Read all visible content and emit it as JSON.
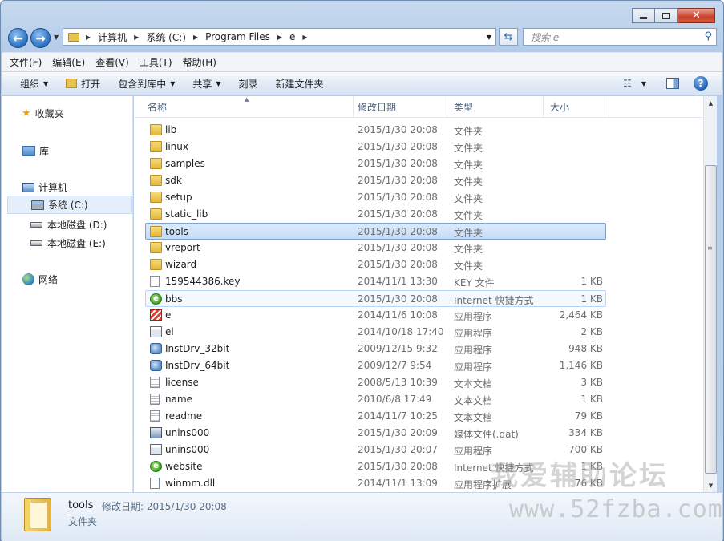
{
  "window": {
    "close_glyph": "✕"
  },
  "address": {
    "crumbs": [
      "计算机",
      "系统 (C:)",
      "Program Files",
      "e"
    ],
    "search_placeholder": "搜索 e"
  },
  "menu": [
    "文件(F)",
    "编辑(E)",
    "查看(V)",
    "工具(T)",
    "帮助(H)"
  ],
  "commands": {
    "organize": "组织",
    "open": "打开",
    "include_in_library": "包含到库中",
    "share": "共享",
    "burn": "刻录",
    "new_folder": "新建文件夹"
  },
  "navpane": {
    "favorites": "收藏夹",
    "libraries": "库",
    "computer": "计算机",
    "drive_c": "系统 (C:)",
    "drive_d": "本地磁盘 (D:)",
    "drive_e": "本地磁盘 (E:)",
    "network": "网络"
  },
  "columns": {
    "name": "名称",
    "date": "修改日期",
    "type": "类型",
    "size": "大小"
  },
  "files": [
    {
      "name": "lib",
      "date": "2015/1/30 20:08",
      "type": "文件夹",
      "size": "",
      "icon": "folder"
    },
    {
      "name": "linux",
      "date": "2015/1/30 20:08",
      "type": "文件夹",
      "size": "",
      "icon": "folder"
    },
    {
      "name": "samples",
      "date": "2015/1/30 20:08",
      "type": "文件夹",
      "size": "",
      "icon": "folder"
    },
    {
      "name": "sdk",
      "date": "2015/1/30 20:08",
      "type": "文件夹",
      "size": "",
      "icon": "folder"
    },
    {
      "name": "setup",
      "date": "2015/1/30 20:08",
      "type": "文件夹",
      "size": "",
      "icon": "folder"
    },
    {
      "name": "static_lib",
      "date": "2015/1/30 20:08",
      "type": "文件夹",
      "size": "",
      "icon": "folder"
    },
    {
      "name": "tools",
      "date": "2015/1/30 20:08",
      "type": "文件夹",
      "size": "",
      "icon": "folder"
    },
    {
      "name": "vreport",
      "date": "2015/1/30 20:08",
      "type": "文件夹",
      "size": "",
      "icon": "folder"
    },
    {
      "name": "wizard",
      "date": "2015/1/30 20:08",
      "type": "文件夹",
      "size": "",
      "icon": "folder"
    },
    {
      "name": "159544386.key",
      "date": "2014/11/1 13:30",
      "type": "KEY 文件",
      "size": "1 KB",
      "icon": "file"
    },
    {
      "name": "bbs",
      "date": "2015/1/30 20:08",
      "type": "Internet 快捷方式",
      "size": "1 KB",
      "icon": "web"
    },
    {
      "name": "e",
      "date": "2014/11/6 10:08",
      "type": "应用程序",
      "size": "2,464 KB",
      "icon": "e"
    },
    {
      "name": "el",
      "date": "2014/10/18 17:40",
      "type": "应用程序",
      "size": "2 KB",
      "icon": "app"
    },
    {
      "name": "InstDrv_32bit",
      "date": "2009/12/15 9:32",
      "type": "应用程序",
      "size": "948 KB",
      "icon": "setup"
    },
    {
      "name": "InstDrv_64bit",
      "date": "2009/12/7 9:54",
      "type": "应用程序",
      "size": "1,146 KB",
      "icon": "setup"
    },
    {
      "name": "license",
      "date": "2008/5/13 10:39",
      "type": "文本文档",
      "size": "3 KB",
      "icon": "txt"
    },
    {
      "name": "name",
      "date": "2010/6/8 17:49",
      "type": "文本文档",
      "size": "1 KB",
      "icon": "txt"
    },
    {
      "name": "readme",
      "date": "2014/11/7 10:25",
      "type": "文本文档",
      "size": "79 KB",
      "icon": "txt"
    },
    {
      "name": "unins000",
      "date": "2015/1/30 20:09",
      "type": "媒体文件(.dat)",
      "size": "334 KB",
      "icon": "media"
    },
    {
      "name": "unins000",
      "date": "2015/1/30 20:07",
      "type": "应用程序",
      "size": "700 KB",
      "icon": "app"
    },
    {
      "name": "website",
      "date": "2015/1/30 20:08",
      "type": "Internet 快捷方式",
      "size": "1 KB",
      "icon": "web"
    },
    {
      "name": "winmm.dll",
      "date": "2014/11/1 13:09",
      "type": "应用程序扩展",
      "size": "76 KB",
      "icon": "dll"
    }
  ],
  "selected_index": 6,
  "hover_index": 10,
  "details": {
    "name": "tools",
    "modified_label": "修改日期: 2015/1/30 20:08",
    "type": "文件夹"
  },
  "watermark": {
    "line1": "我爱辅助论坛",
    "line2": "www.52fzba.com"
  }
}
